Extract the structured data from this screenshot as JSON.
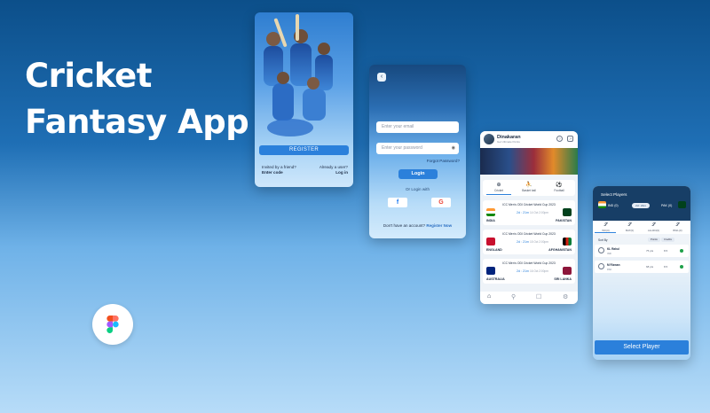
{
  "headline": {
    "line1": "Cricket",
    "line2": "Fantasy App"
  },
  "colors": {
    "accent": "#2b80db",
    "dark_header": "#173e66",
    "live_dot": "#1fa14a"
  },
  "register_screen": {
    "register_label": "REGISTER",
    "invited_text": "Invited by a friend?",
    "enter_code": "Enter code",
    "already_text": "Already a user?",
    "login_link": "Log in"
  },
  "login_screen": {
    "back_icon": "chevron-left-icon",
    "email_placeholder": "Enter your email",
    "password_placeholder": "Enter your password",
    "forgot": "Forgot Password?",
    "login_label": "Login",
    "or_text": "Or Login with",
    "facebook": "f",
    "google": "G",
    "no_account": "Don't have an account?",
    "register_now": "Register Now"
  },
  "home_screen": {
    "user_name": "Dinakaran",
    "user_sub": "Get Ultimate Points",
    "categories": [
      {
        "label": "Cricket",
        "icon": "⊕"
      },
      {
        "label": "Basket ball",
        "icon": "⛹"
      },
      {
        "label": "Football",
        "icon": "⚽"
      }
    ],
    "matches": [
      {
        "title": "ICC Men's ODI Cricket World Cup 2023",
        "team1": "INDIA",
        "team2": "PAKISTAN",
        "time": "2d : 21m",
        "date": "14 Oct 2:00pm",
        "flag1": "#ff9933",
        "flag2": "#01411c"
      },
      {
        "title": "ICC Men's ODI Cricket World Cup 2023",
        "team1": "ENGLAND",
        "team2": "AFGHANISTAN",
        "time": "2d : 21m",
        "date": "15 Oct 2:00pm",
        "flag1": "#c8102e",
        "flag2": "#d32011"
      },
      {
        "title": "ICC Men's ODI Cricket World Cup 2023",
        "team1": "AUSTRALIA",
        "team2": "SRI LANKA",
        "time": "2d : 21m",
        "date": "16 Oct 2:00pm",
        "flag1": "#00247d",
        "flag2": "#8d153a"
      }
    ]
  },
  "select_screen": {
    "title": "Select Players",
    "team1": "IND (0)",
    "team2": "PAK (0)",
    "vs_label": "2d : 21m",
    "roles": [
      {
        "label": "WK(0)",
        "icon": "𝒮"
      },
      {
        "label": "BAT(0)",
        "icon": "𝒮"
      },
      {
        "label": "ALLRD(0)",
        "icon": "𝒮"
      },
      {
        "label": "BWL(0)",
        "icon": "𝒮"
      }
    ],
    "sort_by": "Sort By",
    "chips": [
      "Points",
      "Credits"
    ],
    "players": [
      {
        "name": "KL Rahul",
        "team": "IND",
        "stat1": "75 pts",
        "stat2": "8.5"
      },
      {
        "name": "M Rizwan",
        "team": "PAK",
        "stat1": "68 pts",
        "stat2": "8.5"
      }
    ],
    "select_label": "Select Player"
  }
}
